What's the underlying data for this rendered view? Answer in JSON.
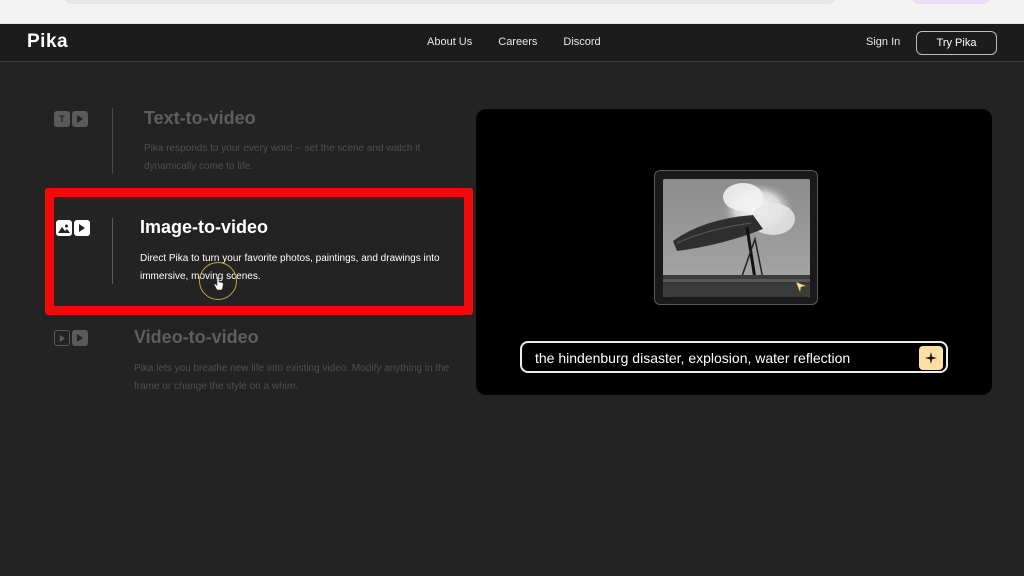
{
  "header": {
    "logo": "Pika",
    "nav_links": [
      "About Us",
      "Careers",
      "Discord"
    ],
    "sign_in": "Sign In",
    "try_button": "Try Pika"
  },
  "features": [
    {
      "title": "Text-to-video",
      "description": "Pika responds to your every word -- set the scene and watch it dynamically come to life.",
      "state": "inactive",
      "icons": [
        "text-icon",
        "play-icon"
      ]
    },
    {
      "title": "Image-to-video",
      "description": "Direct Pika to turn your favorite photos, paintings, and drawings into immersive, moving scenes.",
      "state": "active",
      "icons": [
        "image-icon",
        "play-icon"
      ]
    },
    {
      "title": "Video-to-video",
      "description": "Pika lets you breathe new life into existing video. Modify anything in the frame or change the style on a whim.",
      "state": "inactive",
      "icons": [
        "play-outline-icon",
        "play-icon"
      ]
    }
  ],
  "demo": {
    "prompt_text": "the hindenburg disaster, explosion, water reflection",
    "submit_icon": "sparkle-icon"
  },
  "colors": {
    "background": "#232323",
    "highlight": "#f20a0a",
    "sparkle_button": "#fddfa4"
  }
}
